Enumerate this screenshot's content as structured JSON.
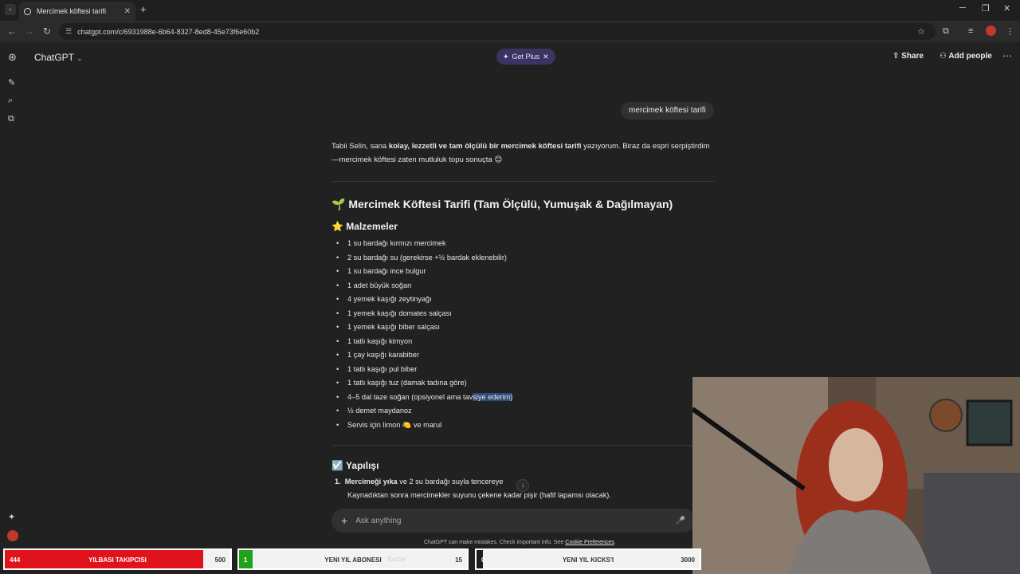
{
  "browser": {
    "tab_title": "Mercimek köftesi tarifi",
    "url": "chatgpt.com/c/6931988e-6b64-8327-8ed8-45e73f6e60b2"
  },
  "header": {
    "model_label": "ChatGPT",
    "get_plus": "Get Plus",
    "share": "Share",
    "add_people": "Add people"
  },
  "conversation": {
    "user_message": "mercimek köftesi tarifi",
    "intro_prefix": "Tabii Selin, sana ",
    "intro_bold": "kolay, lezzetli ve tam ölçülü bir mercimek köftesi tarifi",
    "intro_suffix": " yazıyorum. Biraz da espri serpiştirdim—mercimek köftesi zaten mutluluk topu sonuçta 😊",
    "title": "🌱 Mercimek Köftesi Tarifi (Tam Ölçülü, Yumuşak & Dağılmayan)",
    "ingredients_heading": "⭐ Malzemeler",
    "ingredients": [
      "1 su bardağı kırmızı mercimek",
      "2 su bardağı su (gerekirse +½ bardak eklenebilir)",
      "1 su bardağı ince bulgur",
      "1 adet büyük soğan",
      "4 yemek kaşığı zeytinyağı",
      "1 yemek kaşığı domates salçası",
      "1 yemek kaşığı biber salçası",
      "1 tatlı kaşığı kimyon",
      "1 çay kaşığı karabiber",
      "1 tatlı kaşığı pul biber",
      "1 tatlı kaşığı tuz (damak tadına göre)",
      "4–5 dal taze soğan (opsiyonel ama tavsiye ederim)",
      "½ demet maydanoz",
      "Servis için limon 🍋 ve marul"
    ],
    "steps_heading": "☑️ Yapılışı",
    "step1_num": "1.",
    "step1_bold": "Mercimeği yıka",
    "step1_rest": " ve 2 su bardağı suyla tencereye",
    "step1_line2": "Kaynadıktan sonra mercimekler suyunu çekene kadar pişir (hafif lapamsı olacak)."
  },
  "composer": {
    "placeholder": "Ask anything",
    "disclaimer": "ChatGPT can make mistakes. Check important info. See ",
    "disclaimer_link": "Cookie Preferences",
    "disclaimer_end": "."
  },
  "stream_overlays": [
    {
      "count": "444",
      "label": "YILBASI TAKIPCISI",
      "goal": "500",
      "color": "#e0121b"
    },
    {
      "count": "1",
      "label": "YENI YIL ABONESI",
      "goal": "15",
      "color": "#1fa319"
    },
    {
      "count": "0",
      "label": "YENI YIL KICKS'I",
      "goal": "3000",
      "color": "#1d1d1d"
    }
  ],
  "taskbar": {
    "search": "Suche"
  }
}
